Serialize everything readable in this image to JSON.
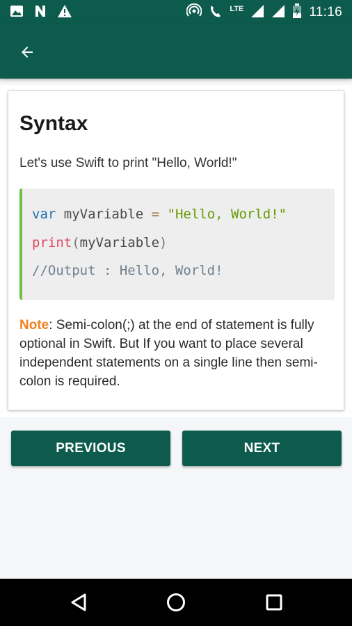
{
  "status_bar": {
    "time": "11:16",
    "network_label": "LTE",
    "left_icons": [
      "image-icon",
      "n-icon",
      "warning-icon"
    ],
    "right_icons": [
      "hotspot-icon",
      "wifi-call-icon",
      "signal-icon",
      "signal-icon",
      "battery-icon"
    ]
  },
  "app_bar": {
    "color": "#0c5b4c",
    "back_icon": "arrow-back-icon"
  },
  "content": {
    "title": "Syntax",
    "intro": "Let's use Swift to print \"Hello, World!\"",
    "code": {
      "line1": {
        "keyword": "var",
        "name": " myVariable",
        "op": " = ",
        "string": "\"Hello, World!\""
      },
      "line2": {
        "func": "print",
        "open": "(",
        "arg": "myVariable",
        "close": ")"
      },
      "line3": {
        "comment": "//Output : Hello, World!"
      }
    },
    "note": {
      "label": "Note",
      "text": ":  Semi-colon(;) at the end of statement is fully optional in Swift. But If you want to place several independent statements on a single line then semi-colon is required."
    }
  },
  "buttons": {
    "previous": "PREVIOUS",
    "next": "NEXT"
  },
  "nav_bar": {
    "icons": [
      "back-triangle-icon",
      "home-circle-icon",
      "recents-square-icon"
    ]
  }
}
